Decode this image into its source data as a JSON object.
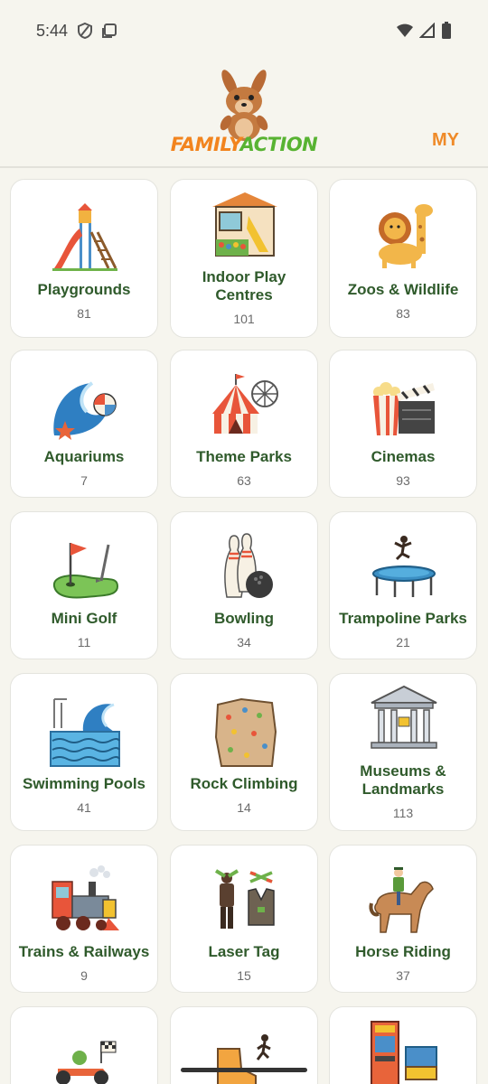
{
  "status": {
    "time": "5:44"
  },
  "header": {
    "logo_part1": "FAMILY",
    "logo_part2": "ACTION",
    "my_label": "MY"
  },
  "categories": [
    {
      "name": "Playgrounds",
      "count": "81"
    },
    {
      "name": "Indoor Play Centres",
      "count": "101"
    },
    {
      "name": "Zoos & Wildlife",
      "count": "83"
    },
    {
      "name": "Aquariums",
      "count": "7"
    },
    {
      "name": "Theme Parks",
      "count": "63"
    },
    {
      "name": "Cinemas",
      "count": "93"
    },
    {
      "name": "Mini Golf",
      "count": "11"
    },
    {
      "name": "Bowling",
      "count": "34"
    },
    {
      "name": "Trampoline Parks",
      "count": "21"
    },
    {
      "name": "Swimming Pools",
      "count": "41"
    },
    {
      "name": "Rock Climbing",
      "count": "14"
    },
    {
      "name": "Museums & Landmarks",
      "count": "113"
    },
    {
      "name": "Trains & Railways",
      "count": "9"
    },
    {
      "name": "Laser Tag",
      "count": "15"
    },
    {
      "name": "Horse Riding",
      "count": "37"
    }
  ],
  "icons": {
    "playgrounds": "slide-icon",
    "indoor_play": "playhouse-icon",
    "zoos": "giraffe-lion-icon",
    "aquariums": "wave-ball-icon",
    "theme_parks": "circus-tent-icon",
    "cinemas": "popcorn-clapper-icon",
    "mini_golf": "golf-flag-icon",
    "bowling": "bowling-pins-icon",
    "trampoline": "trampoline-icon",
    "swimming": "pool-wave-icon",
    "rock_climbing": "climbing-wall-icon",
    "museums": "museum-building-icon",
    "trains": "steam-train-icon",
    "laser_tag": "laser-tag-icon",
    "horse_riding": "horse-rider-icon",
    "go_karts": "go-kart-icon",
    "skating": "roller-skate-icon",
    "arcades": "arcade-machine-icon"
  },
  "colors": {
    "background": "#f6f5ee",
    "accent": "#ef8a28",
    "label": "#2f5a2b"
  }
}
